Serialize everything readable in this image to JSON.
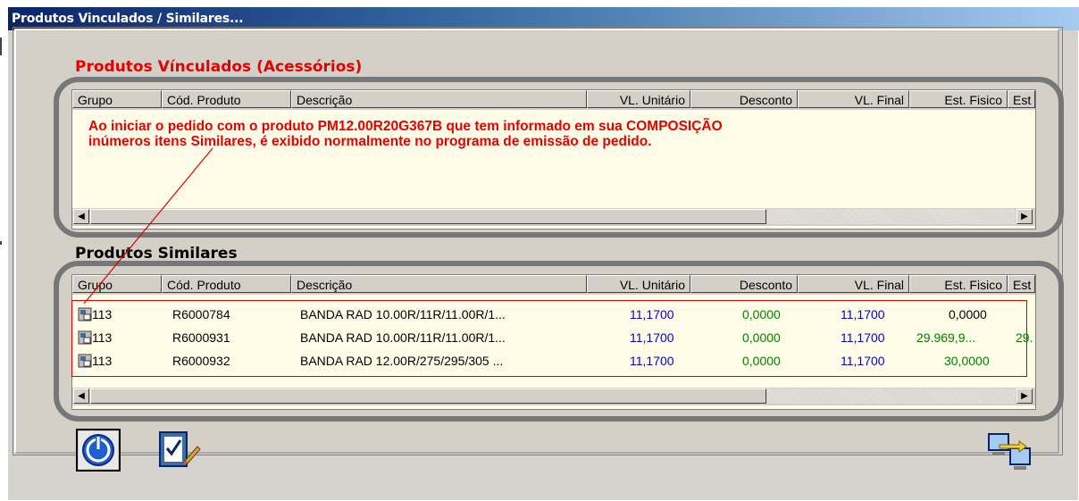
{
  "window": {
    "title": "Produtos Vinculados / Similares..."
  },
  "vinculados": {
    "title": "Produtos Vínculados (Acessórios)",
    "columns": [
      "Grupo",
      "Cód. Produto",
      "Descrição",
      "VL. Unitário",
      "Desconto",
      "VL. Final",
      "Est. Fisico",
      "Est"
    ],
    "note_line1": "Ao iniciar o pedido com o produto PM12.00R20G367B que tem informado em sua COMPOSIÇÃO",
    "note_line2": "inúmeros itens Similares, é exibido normalmente no programa de emissão de pedido."
  },
  "similares": {
    "title": "Produtos Similares",
    "columns": [
      "Grupo",
      "Cód. Produto",
      "Descrição",
      "VL. Unitário",
      "Desconto",
      "VL. Final",
      "Est. Fisico",
      "Est"
    ],
    "rows": [
      {
        "grupo": "113",
        "codigo": "R6000784",
        "descricao": "BANDA RAD 10.00R/11R/11.00R/1...",
        "vl_unitario": "11,1700",
        "desconto": "0,0000",
        "vl_final": "11,1700",
        "est_fisico": "0,0000",
        "est": ""
      },
      {
        "grupo": "113",
        "codigo": "R6000931",
        "descricao": "BANDA RAD 10.00R/11R/11.00R/1...",
        "vl_unitario": "11,1700",
        "desconto": "0,0000",
        "vl_final": "11,1700",
        "est_fisico": "29.969,9...",
        "est": "29."
      },
      {
        "grupo": "113",
        "codigo": "R6000932",
        "descricao": "BANDA RAD 12.00R/275/295/305 ...",
        "vl_unitario": "11,1700",
        "desconto": "0,0000",
        "vl_final": "11,1700",
        "est_fisico": "30,0000",
        "est": ""
      }
    ]
  },
  "colors": {
    "blue_value": "#0000e0",
    "green_value": "#008000",
    "red_title": "#e80000",
    "highlight_box": "#e00000"
  },
  "toolbar": {
    "power_icon": "power-icon",
    "edit_icon": "edit-check-icon",
    "sync_icon": "sync-computers-icon"
  },
  "scroll": {
    "left_arrow": "◀",
    "right_arrow": "▶"
  }
}
